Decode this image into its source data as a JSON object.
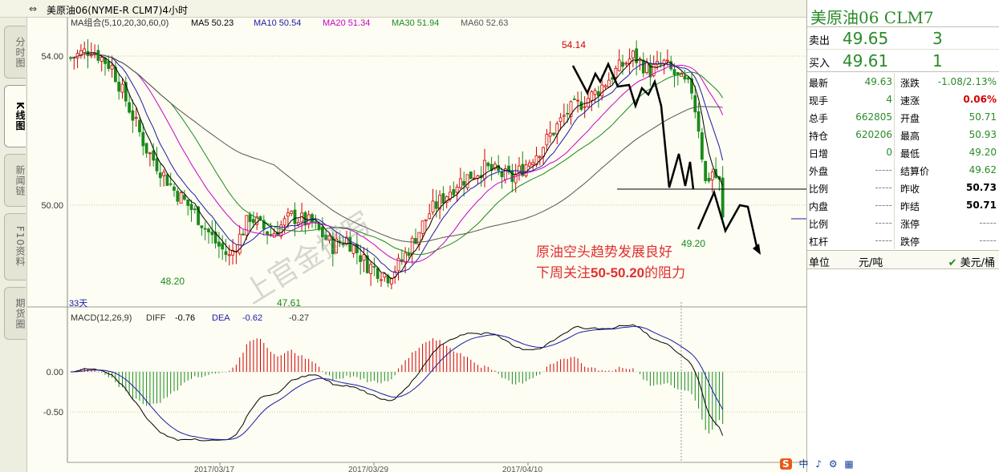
{
  "window": {
    "title": "美原油06(NYME-R CLM7)4小时",
    "link_icon": "link-icon"
  },
  "tabs": [
    {
      "label": "分时图",
      "active": false
    },
    {
      "label": "K线图",
      "active": true
    },
    {
      "label": "新闻链",
      "active": false
    },
    {
      "label": "F10资料",
      "active": false
    },
    {
      "label": "期货圈",
      "active": false
    }
  ],
  "price_chart": {
    "ma_group_label": "MA组合(5,10,20,30,60,0)",
    "ma_legend": [
      {
        "label": "MA5 50.23",
        "color": "#000000"
      },
      {
        "label": "MA10 50.54",
        "color": "#1a1aa8"
      },
      {
        "label": "MA20 51.34",
        "color": "#c800c8"
      },
      {
        "label": "MA30 51.94",
        "color": "#1a8a1a"
      },
      {
        "label": "MA60 52.63",
        "color": "#555555"
      }
    ],
    "y_ticks": [
      "54.00",
      "50.00"
    ],
    "annotations": {
      "high_label": "54.14",
      "low1_label": "48.20",
      "low2_label": "47.61",
      "recent_low_label": "49.20",
      "days_label": "33天"
    },
    "commentary_line1": "原油空头趋势发展良好",
    "commentary_line2_prefix": "下周关注",
    "commentary_line2_range": "50-50.20",
    "commentary_line2_suffix": "的阻力",
    "watermark": "上官金撰写"
  },
  "macd_chart": {
    "label": "MACD(12,26,9)",
    "diff_label": "DIFF",
    "diff_value": "-0.76",
    "dea_label": "DEA",
    "dea_value": "-0.62",
    "macd_value": "-0.27",
    "y_ticks": [
      "0.00",
      "-0.50"
    ]
  },
  "x_axis": {
    "dates": [
      "2017/03/17",
      "2017/03/29",
      "2017/04/10"
    ]
  },
  "quote_panel": {
    "title": "美原油06  CLM7",
    "sell_label": "卖出",
    "sell_price": "49.65",
    "sell_volume": "3",
    "buy_label": "买入",
    "buy_price": "49.61",
    "buy_volume": "1",
    "left_fields": [
      {
        "label": "最新",
        "value": "49.63",
        "color": "green"
      },
      {
        "label": "现手",
        "value": "4",
        "color": "green"
      },
      {
        "label": "总手",
        "value": "662805",
        "color": "green"
      },
      {
        "label": "持仓",
        "value": "620206",
        "color": "green"
      },
      {
        "label": "日增",
        "value": "0",
        "color": "green"
      },
      {
        "label": "外盘",
        "value": "-----",
        "color": "grey"
      },
      {
        "label": "比例",
        "value": "-----",
        "color": "grey"
      },
      {
        "label": "内盘",
        "value": "-----",
        "color": "grey"
      },
      {
        "label": "比例",
        "value": "-----",
        "color": "grey"
      },
      {
        "label": "杠杆",
        "value": "-----",
        "color": "grey"
      }
    ],
    "right_fields": [
      {
        "label": "涨跌",
        "value": "-1.08/2.13%",
        "color": "green"
      },
      {
        "label": "速涨",
        "value": "0.06%",
        "color": "red"
      },
      {
        "label": "开盘",
        "value": "50.71",
        "color": "green"
      },
      {
        "label": "最高",
        "value": "50.93",
        "color": "green"
      },
      {
        "label": "最低",
        "value": "49.20",
        "color": "green"
      },
      {
        "label": "结算价",
        "value": "49.62",
        "color": "green"
      },
      {
        "label": "昨收",
        "value": "50.73",
        "color": "black"
      },
      {
        "label": "昨结",
        "value": "50.71",
        "color": "black"
      },
      {
        "label": "涨停",
        "value": "-----",
        "color": "grey"
      },
      {
        "label": "跌停",
        "value": "-----",
        "color": "grey"
      }
    ],
    "unit_label": "单位",
    "unit_value": "元/吨",
    "currency_value": "美元/桶"
  },
  "status_bar": {
    "items": [
      "中",
      "♪",
      "⚙",
      "▦"
    ]
  },
  "colors": {
    "up": "#d40000",
    "down": "#1a8a1a",
    "ma5": "#000000",
    "ma10": "#1a1aa8",
    "ma20": "#c800c8",
    "ma30": "#1a8a1a",
    "ma60": "#555555",
    "commentary": "#e03030"
  }
}
